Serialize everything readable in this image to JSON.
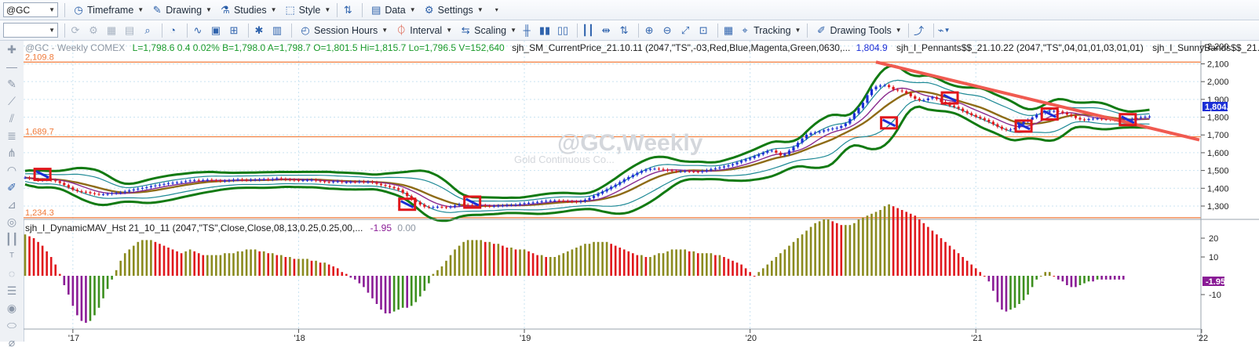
{
  "toolbar1": {
    "symbol": "@GC",
    "menus": [
      {
        "label": "Timeframe",
        "icon": "clock-icon"
      },
      {
        "label": "Drawing",
        "icon": "pencil-icon"
      },
      {
        "label": "Studies",
        "icon": "flask-icon"
      },
      {
        "label": "Style",
        "icon": "style-icon"
      },
      {
        "label": "Data",
        "icon": "data-icon"
      },
      {
        "label": "Settings",
        "icon": "gear-icon"
      }
    ]
  },
  "toolbar2": {
    "menus": [
      {
        "label": "Session Hours",
        "icon": "session-icon"
      },
      {
        "label": "Interval",
        "icon": "interval-icon"
      },
      {
        "label": "Scaling",
        "icon": "scaling-icon"
      },
      {
        "label": "Tracking",
        "icon": "tracking-icon"
      },
      {
        "label": "Drawing Tools",
        "icon": "drawing-tools-icon"
      }
    ]
  },
  "header": {
    "symbol_line": "@GC - Weekly  COMEX",
    "quote": "L=1,798.6  0.4  0.02%  B=1,798.0  A=1,798.7  O=1,801.5  Hi=1,815.7  Lo=1,796.5  V=152,640",
    "study1": "sjh_SM_CurrentPrice_21.10.11 (2047,\"TS\",-03,Red,Blue,Magenta,Green,0630,...",
    "study1_value": "1,804.9",
    "study2": "sjh_I_Pennants$$_21.10.22 (2047,\"TS\",04,01,01,03,01,01)",
    "study3": "sjh_I_SunnyBands$$_21.10.22 ...",
    "watermark": "@GC,Weekly",
    "watermark_sub": "Gold Continuous Co..."
  },
  "lower": {
    "title": "sjh_I_DynamicMAV_Hst 21_10_11 (2047,\"TS\",Close,Close,08,13,0.25,0.25,00,...",
    "value1": "-1.95",
    "value2": "0.00",
    "price_label": "-1.95"
  },
  "colors": {
    "up": "#1b2fd6",
    "down": "#e0161b",
    "band_outer": "#127a12",
    "band_inner": "#1f8a96",
    "mav": "#8e6b16",
    "hline": "#f07a3a",
    "hist_red": "#e0161b",
    "hist_olive": "#8a8a1e",
    "hist_green": "#3c8f1e",
    "hist_purple": "#8a1c96",
    "trend": "#f05a50"
  },
  "chart_data": {
    "type": "line",
    "price_axis_ticks": [
      "2,200",
      "2,100",
      "2,000",
      "1,900",
      "1,800",
      "1,700",
      "1,600",
      "1,500",
      "1,400",
      "1,300"
    ],
    "ylim": [
      1225,
      2230
    ],
    "hlines": [
      {
        "label": "2,109.8",
        "value": 2109.8
      },
      {
        "label": "1,689.7",
        "value": 1689.7
      },
      {
        "label": "1,234.3",
        "value": 1234.3
      }
    ],
    "x_ticks": [
      {
        "label": "'17",
        "week": 11
      },
      {
        "label": "'18",
        "week": 63
      },
      {
        "label": "'19",
        "week": 115
      },
      {
        "label": "'20",
        "week": 167
      },
      {
        "label": "'21",
        "week": 219
      },
      {
        "label": "'22",
        "week": 271
      }
    ],
    "closes": [
      1460,
      1455,
      1450,
      1445,
      1448,
      1452,
      1446,
      1440,
      1430,
      1418,
      1405,
      1392,
      1384,
      1380,
      1378,
      1372,
      1368,
      1366,
      1366,
      1368,
      1372,
      1374,
      1376,
      1382,
      1388,
      1393,
      1398,
      1402,
      1406,
      1412,
      1416,
      1420,
      1424,
      1428,
      1431,
      1433,
      1435,
      1440,
      1444,
      1446,
      1445,
      1446,
      1448,
      1444,
      1443,
      1440,
      1442,
      1444,
      1448,
      1450,
      1447,
      1446,
      1448,
      1448,
      1450,
      1451,
      1449,
      1452,
      1456,
      1452,
      1449,
      1448,
      1446,
      1444,
      1445,
      1446,
      1447,
      1443,
      1440,
      1436,
      1435,
      1438,
      1439,
      1434,
      1434,
      1436,
      1435,
      1438,
      1434,
      1436,
      1433,
      1425,
      1418,
      1413,
      1407,
      1400,
      1391,
      1375,
      1356,
      1338,
      1322,
      1308,
      1296,
      1293,
      1294,
      1296,
      1294,
      1292,
      1296,
      1303,
      1310,
      1307,
      1306,
      1304,
      1303,
      1304,
      1300,
      1298,
      1300,
      1302,
      1303,
      1306,
      1306,
      1308,
      1312,
      1316,
      1318,
      1320,
      1323,
      1326,
      1329,
      1330,
      1331,
      1330,
      1328,
      1326,
      1325,
      1323,
      1327,
      1335,
      1345,
      1357,
      1370,
      1382,
      1395,
      1408,
      1420,
      1435,
      1450,
      1463,
      1475,
      1487,
      1497,
      1504,
      1510,
      1510,
      1508,
      1504,
      1500,
      1496,
      1495,
      1496,
      1496,
      1495,
      1494,
      1492,
      1497,
      1502,
      1508,
      1512,
      1517,
      1523,
      1529,
      1535,
      1545,
      1554,
      1562,
      1570,
      1580,
      1590,
      1600,
      1610,
      1612,
      1600,
      1585,
      1592,
      1612,
      1632,
      1656,
      1680,
      1701,
      1710,
      1714,
      1719,
      1726,
      1732,
      1736,
      1740,
      1750,
      1764,
      1790,
      1822,
      1852,
      1881,
      1924,
      1957,
      1972,
      1978,
      1980,
      1970,
      1955,
      1950,
      1946,
      1935,
      1918,
      1904,
      1895,
      1896,
      1905,
      1912,
      1902,
      1886,
      1877,
      1865,
      1858,
      1848,
      1834,
      1822,
      1812,
      1802,
      1794,
      1785,
      1774,
      1760,
      1746,
      1734,
      1728,
      1731,
      1740,
      1760,
      1776,
      1785,
      1798,
      1814,
      1823,
      1828,
      1832,
      1835,
      1832,
      1824,
      1815,
      1808,
      1796,
      1787,
      1784,
      1790,
      1792,
      1792,
      1789,
      1788,
      1786,
      1784,
      1783,
      1781,
      1784,
      1790,
      1796,
      1800,
      1802,
      1804
    ],
    "hist": [
      22,
      21,
      20,
      18,
      16,
      13,
      10,
      6,
      1,
      -5,
      -10,
      -16,
      -21,
      -24,
      -25,
      -24,
      -21,
      -17,
      -12,
      -7,
      -2,
      3,
      8,
      12,
      14,
      16,
      18,
      19,
      19,
      19,
      18,
      17,
      16,
      15,
      14,
      13,
      12,
      13,
      14,
      13,
      12,
      11,
      11,
      11,
      11,
      11,
      12,
      12,
      12,
      13,
      13,
      14,
      14,
      14,
      13,
      13,
      12,
      12,
      11,
      11,
      10,
      10,
      9,
      9,
      9,
      9,
      8,
      8,
      7,
      7,
      6,
      5,
      4,
      2,
      1,
      -1,
      -2,
      -4,
      -6,
      -9,
      -12,
      -15,
      -18,
      -20,
      -20,
      -19,
      -18,
      -17,
      -17,
      -16,
      -14,
      -11,
      -8,
      -4,
      1,
      3,
      5,
      8,
      11,
      14,
      16,
      18,
      19,
      19,
      19,
      19,
      18,
      18,
      17,
      17,
      16,
      15,
      15,
      14,
      14,
      14,
      13,
      12,
      11,
      11,
      10,
      10,
      10,
      11,
      12,
      13,
      14,
      15,
      16,
      17,
      17,
      18,
      18,
      18,
      18,
      17,
      16,
      15,
      14,
      13,
      12,
      11,
      11,
      10,
      10,
      11,
      12,
      12,
      13,
      14,
      14,
      14,
      14,
      13,
      13,
      12,
      12,
      12,
      12,
      11,
      11,
      10,
      9,
      8,
      7,
      6,
      4,
      2,
      0,
      2,
      4,
      6,
      8,
      10,
      12,
      14,
      16,
      18,
      20,
      22,
      24,
      26,
      28,
      29,
      30,
      30,
      29,
      28,
      27,
      27,
      27,
      28,
      30,
      31,
      32,
      33,
      34,
      35,
      37,
      38,
      37,
      36,
      35,
      34,
      33,
      32,
      30,
      28,
      26,
      24,
      22,
      20,
      18,
      16,
      14,
      12,
      10,
      8,
      6,
      4,
      2,
      0,
      -3,
      -8,
      -14,
      -18,
      -19,
      -18,
      -17,
      -15,
      -13,
      -10,
      -6,
      -2,
      0,
      2,
      2,
      0,
      -2,
      -3,
      -5,
      -6,
      -6,
      -5,
      -4,
      -3,
      -3,
      -2,
      -2,
      -2,
      -2,
      -2,
      -2,
      -2
    ]
  }
}
